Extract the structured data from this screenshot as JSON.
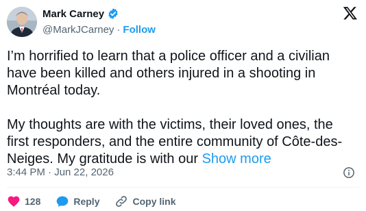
{
  "user": {
    "name": "Mark Carney",
    "handle": "@MarkJCarney",
    "follow_label": "Follow",
    "separator": "·"
  },
  "tweet": {
    "paragraph1": "I’m horrified to learn that a police officer and a civilian have been killed and others injured in a shooting in Montréal today.",
    "paragraph2": "My thoughts are with the victims, their loved ones, the first responders, and the entire community of Côte-des-Neiges. My gratitude is with our",
    "show_more": "Show more",
    "timestamp": "3:44 PM · Jun 22, 2026"
  },
  "actions": {
    "like_count": "128",
    "reply_label": "Reply",
    "copy_label": "Copy link"
  },
  "icons": {
    "verified": "verified-badge-icon",
    "logo": "x-logo-icon",
    "info": "info-icon",
    "like": "heart-icon",
    "reply": "reply-bubble-icon",
    "link": "link-icon"
  },
  "colors": {
    "accent": "#1d9bf0",
    "like": "#f91880",
    "text": "#0f1419",
    "secondary": "#536471"
  }
}
